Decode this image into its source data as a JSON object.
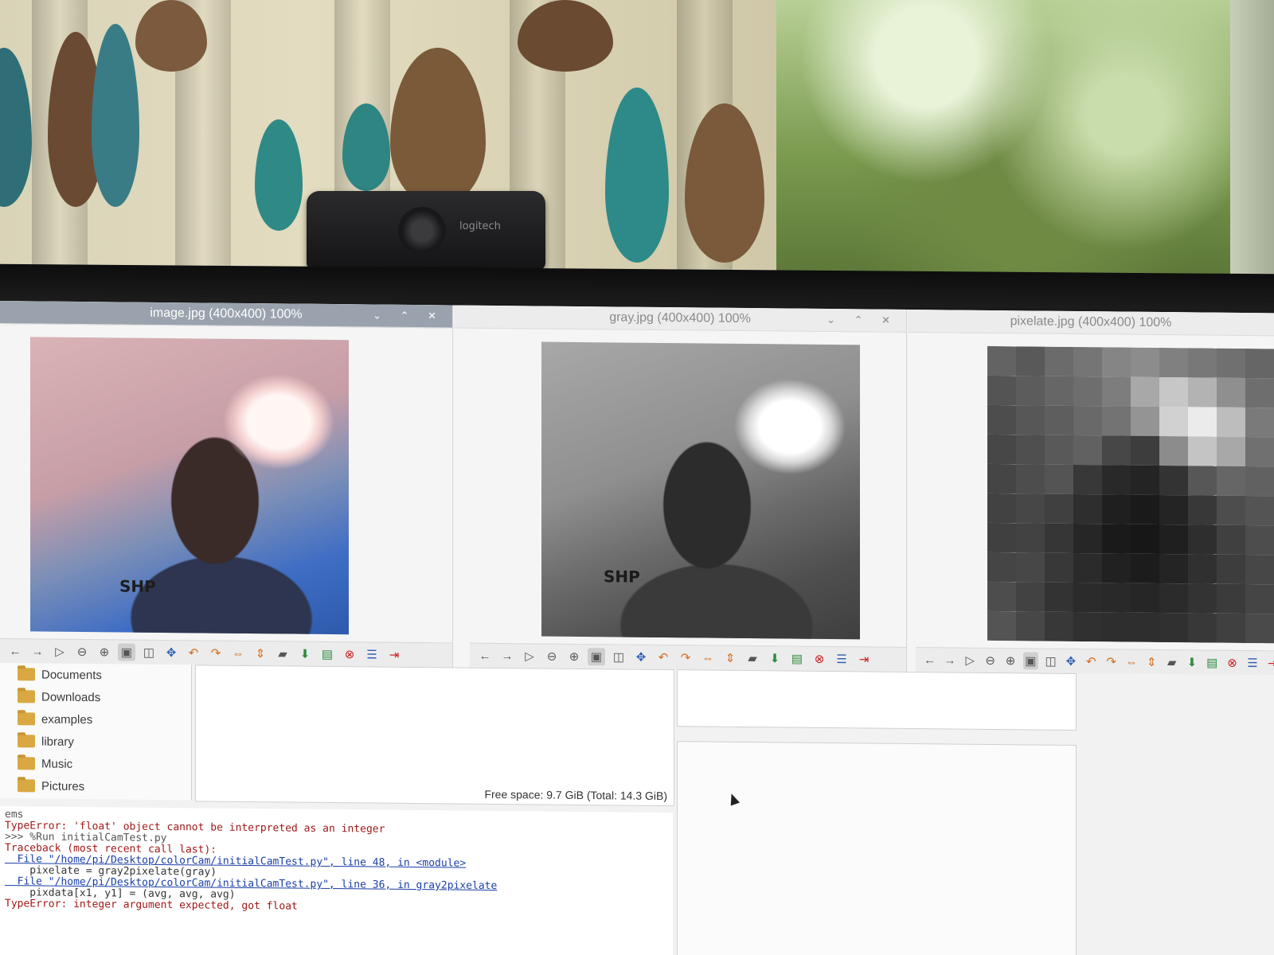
{
  "webcam": {
    "brand": "logitech"
  },
  "viewers": [
    {
      "title": "image.jpg (400x400) 100%",
      "controls": "⌄ ⌃ ✕",
      "photo_text": "SHP"
    },
    {
      "title": "gray.jpg (400x400) 100%",
      "controls": "⌄ ⌃ ✕",
      "photo_text": "SHP"
    },
    {
      "title": "pixelate.jpg (400x400) 100%",
      "controls": ""
    }
  ],
  "pixel_grid": [
    [
      0.39,
      0.35,
      0.42,
      0.46,
      0.52,
      0.55,
      0.5,
      0.47,
      0.44,
      0.4
    ],
    [
      0.33,
      0.36,
      0.4,
      0.43,
      0.49,
      0.66,
      0.78,
      0.7,
      0.56,
      0.43
    ],
    [
      0.3,
      0.34,
      0.37,
      0.41,
      0.45,
      0.58,
      0.82,
      0.92,
      0.74,
      0.48
    ],
    [
      0.28,
      0.31,
      0.35,
      0.38,
      0.28,
      0.24,
      0.55,
      0.77,
      0.66,
      0.44
    ],
    [
      0.27,
      0.3,
      0.33,
      0.22,
      0.16,
      0.14,
      0.2,
      0.34,
      0.4,
      0.38
    ],
    [
      0.26,
      0.28,
      0.25,
      0.18,
      0.12,
      0.1,
      0.14,
      0.22,
      0.3,
      0.33
    ],
    [
      0.25,
      0.26,
      0.21,
      0.15,
      0.1,
      0.09,
      0.12,
      0.18,
      0.25,
      0.3
    ],
    [
      0.27,
      0.28,
      0.22,
      0.17,
      0.13,
      0.11,
      0.14,
      0.19,
      0.24,
      0.28
    ],
    [
      0.3,
      0.26,
      0.2,
      0.17,
      0.16,
      0.15,
      0.17,
      0.2,
      0.23,
      0.27
    ],
    [
      0.33,
      0.28,
      0.22,
      0.19,
      0.18,
      0.18,
      0.19,
      0.22,
      0.25,
      0.29
    ]
  ],
  "file_manager": {
    "folders": [
      "Documents",
      "Downloads",
      "examples",
      "library",
      "Music",
      "Pictures"
    ],
    "status": "Free space: 9.7 GiB (Total: 14.3 GiB)"
  },
  "shell": {
    "tab_fragment": "ems",
    "lines": [
      {
        "cls": "err",
        "text": "TypeError: 'float' object cannot be interpreted as an integer"
      },
      {
        "cls": "prompt",
        "text": ">>> %Run initialCamTest.py"
      },
      {
        "cls": "err",
        "text": "Traceback (most recent call last):"
      },
      {
        "cls": "link",
        "text": "  File \"/home/pi/Desktop/colorCam/initialCamTest.py\", line 48, in <module>"
      },
      {
        "cls": "code",
        "text": "    pixelate = gray2pixelate(gray)"
      },
      {
        "cls": "link",
        "text": "  File \"/home/pi/Desktop/colorCam/initialCamTest.py\", line 36, in gray2pixelate"
      },
      {
        "cls": "code",
        "text": "    pixdata[x1, y1] = (avg, avg, avg)"
      },
      {
        "cls": "err",
        "text": "TypeError: integer argument expected, got float"
      }
    ]
  },
  "toolbar_icons": [
    "back-icon",
    "forward-icon",
    "play-icon",
    "zoom-out-icon",
    "zoom-in-icon",
    "zoom-fit-icon",
    "zoom-original-icon",
    "fullscreen-icon",
    "rotate-left-icon",
    "rotate-right-icon",
    "flip-horizontal-icon",
    "flip-vertical-icon",
    "open-icon",
    "save-icon",
    "save-as-icon",
    "delete-icon",
    "preferences-icon",
    "exit-icon"
  ]
}
